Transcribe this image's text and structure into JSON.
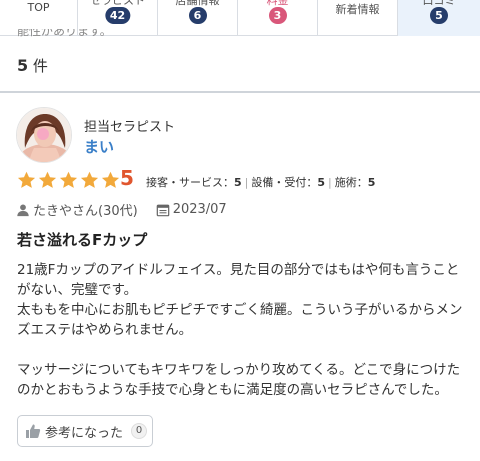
{
  "tabs": [
    {
      "label": "TOP",
      "count": null,
      "accent": "#263d6b",
      "active": false
    },
    {
      "label": "セラピスト",
      "count": "42",
      "accent": "#263d6b",
      "active": false
    },
    {
      "label": "店舗情報",
      "count": "6",
      "accent": "#263d6b",
      "active": false
    },
    {
      "label": "料金",
      "count": "3",
      "accent": "#d9577a",
      "active": false
    },
    {
      "label": "新着情報",
      "count": null,
      "accent": "#263d6b",
      "active": false
    },
    {
      "label": "口コミ",
      "count": "5",
      "accent": "#263d6b",
      "active": true
    }
  ],
  "notice_partial": "能性があります。",
  "review_count": {
    "number": "5",
    "unit": "件"
  },
  "review": {
    "therapist_role": "担当セラピスト",
    "therapist_name": "まい",
    "rating": 5,
    "rating_label": "5",
    "subscores": [
      {
        "label": "接客・サービス：",
        "value": "5"
      },
      {
        "label": "設備・受付：",
        "value": "5"
      },
      {
        "label": "施術：",
        "value": "5"
      }
    ],
    "author": "たきやさん(30代)",
    "date": "2023/07",
    "title": "若さ溢れるFカップ",
    "body_lines": [
      "21歳Fカップのアイドルフェイス。見た目の部分ではもはや何も言うことがない、完璧です。",
      "太ももを中心にお肌もピチピチですごく綺麗。こういう子がいるからメンズエステはやめられません。",
      "",
      "マッサージについてもキワキワをしっかり攻めてくる。どこで身につけたのかとおもうような手技で心身ともに満足度の高いセラピさんでした。"
    ],
    "helpful_label": "参考になった",
    "helpful_count": "0"
  },
  "colors": {
    "star": "#f2a93b",
    "score": "#e0562e",
    "name": "#3a7fc8",
    "navy": "#263d6b",
    "pink": "#d9577a"
  },
  "icons": {
    "author": "user-icon",
    "date": "calendar-icon",
    "helpful": "thumbs-up-icon"
  }
}
